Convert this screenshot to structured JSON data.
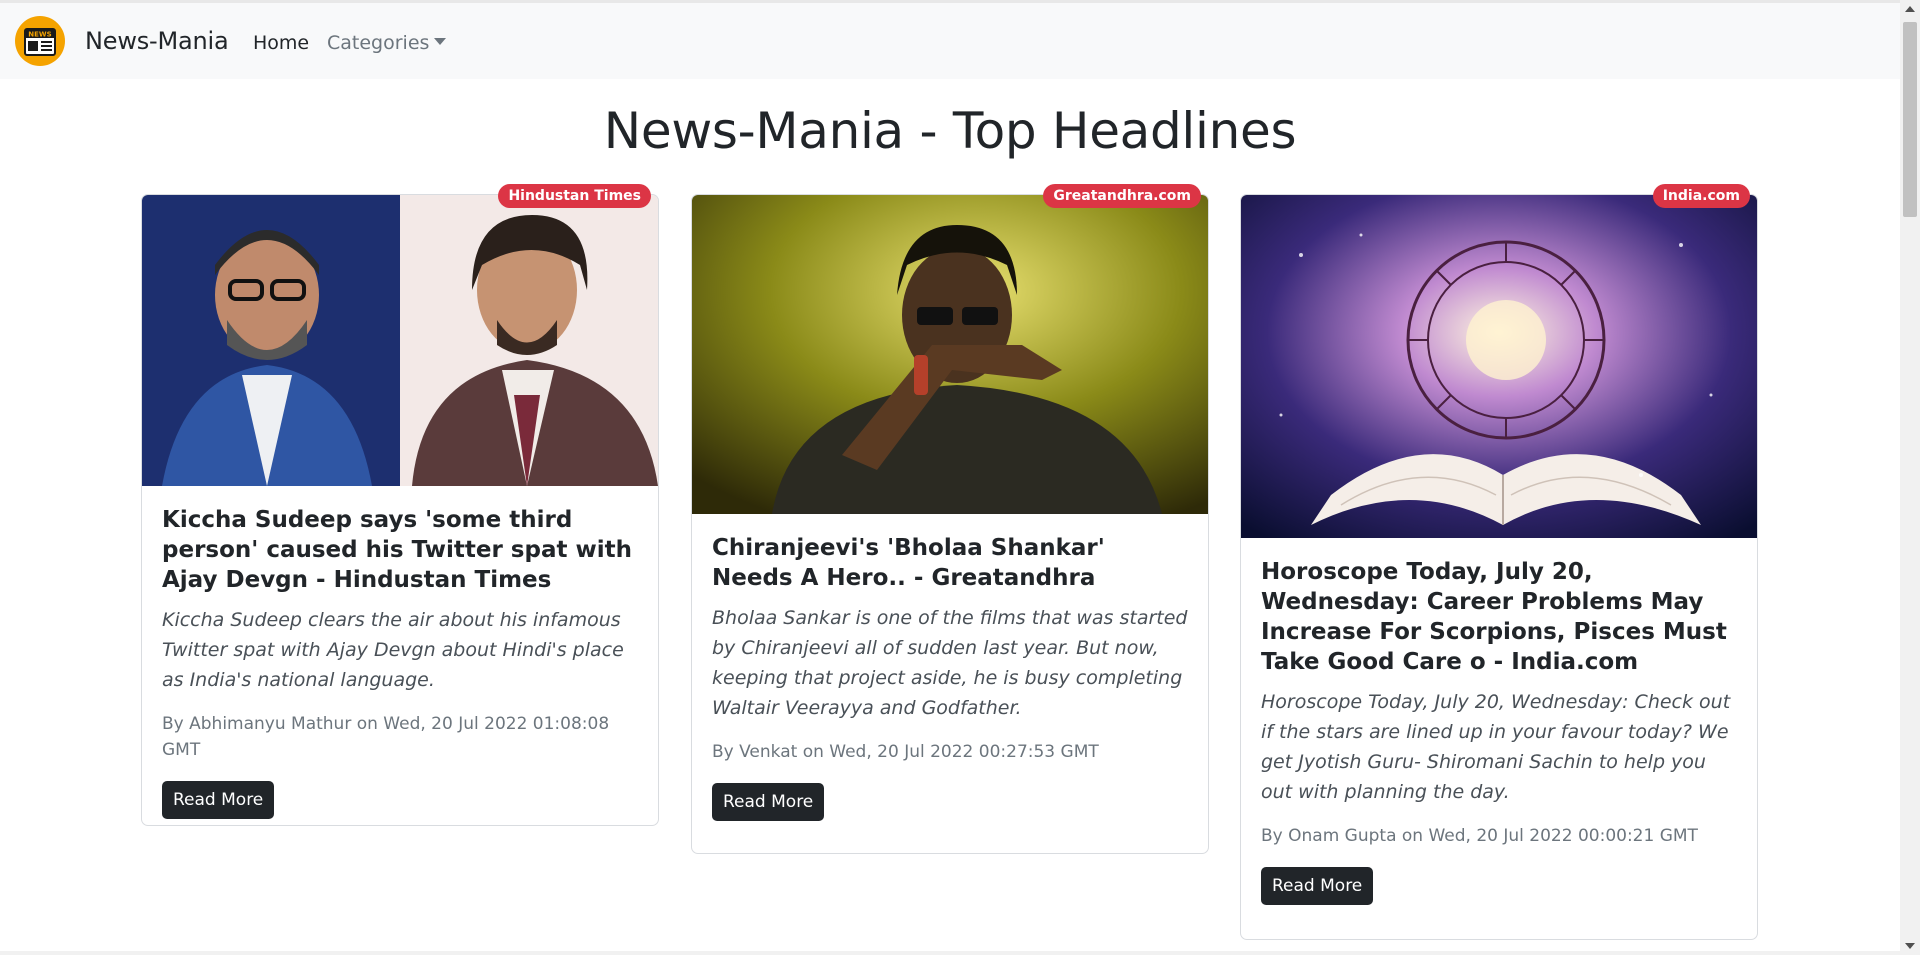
{
  "navbar": {
    "brand": "News-Mania",
    "logo_icon": "newspaper-icon",
    "logo_text": "NEWS",
    "home_label": "Home",
    "categories_label": "Categories"
  },
  "page": {
    "title": "News-Mania - Top Headlines"
  },
  "colors": {
    "badge": "#dc3545",
    "button": "#212529",
    "navbar_bg": "#f8f9fa",
    "logo": "#f5a300"
  },
  "cards": [
    {
      "source": "Hindustan Times",
      "image": "photo of two actors",
      "title": "Kiccha Sudeep says 'some third person' caused his Twitter spat with Ajay Devgn - Hindustan Times",
      "description": "Kiccha Sudeep clears the air about his infamous Twitter spat with Ajay Devgn about Hindi's place as India's national language.",
      "meta": "By Abhimanyu Mathur on Wed, 20 Jul 2022 01:08:08 GMT",
      "button": "Read More"
    },
    {
      "source": "Greatandhra.com",
      "image": "photo of actor in sunglasses",
      "title": "Chiranjeevi's 'Bholaa Shankar' Needs A Hero.. - Greatandhra",
      "description": "Bholaa Sankar is one of the films that was started by Chiranjeevi all of sudden last year. But now, keeping that project aside, he is busy completing Waltair Veerayya and Godfather.",
      "meta": "By Venkat on Wed, 20 Jul 2022 00:27:53 GMT",
      "button": "Read More"
    },
    {
      "source": "India.com",
      "image": "zodiac wheel above open book",
      "title": "Horoscope Today, July 20, Wednesday: Career Problems May Increase For Scorpions, Pisces Must Take Good Care o - India.com",
      "description": "Horoscope Today, July 20, Wednesday: Check out if the stars are lined up in your favour today? We get Jyotish Guru- Shiromani Sachin to help you out with planning the day.",
      "meta": "By Onam Gupta on Wed, 20 Jul 2022 00:00:21 GMT",
      "button": "Read More"
    }
  ]
}
